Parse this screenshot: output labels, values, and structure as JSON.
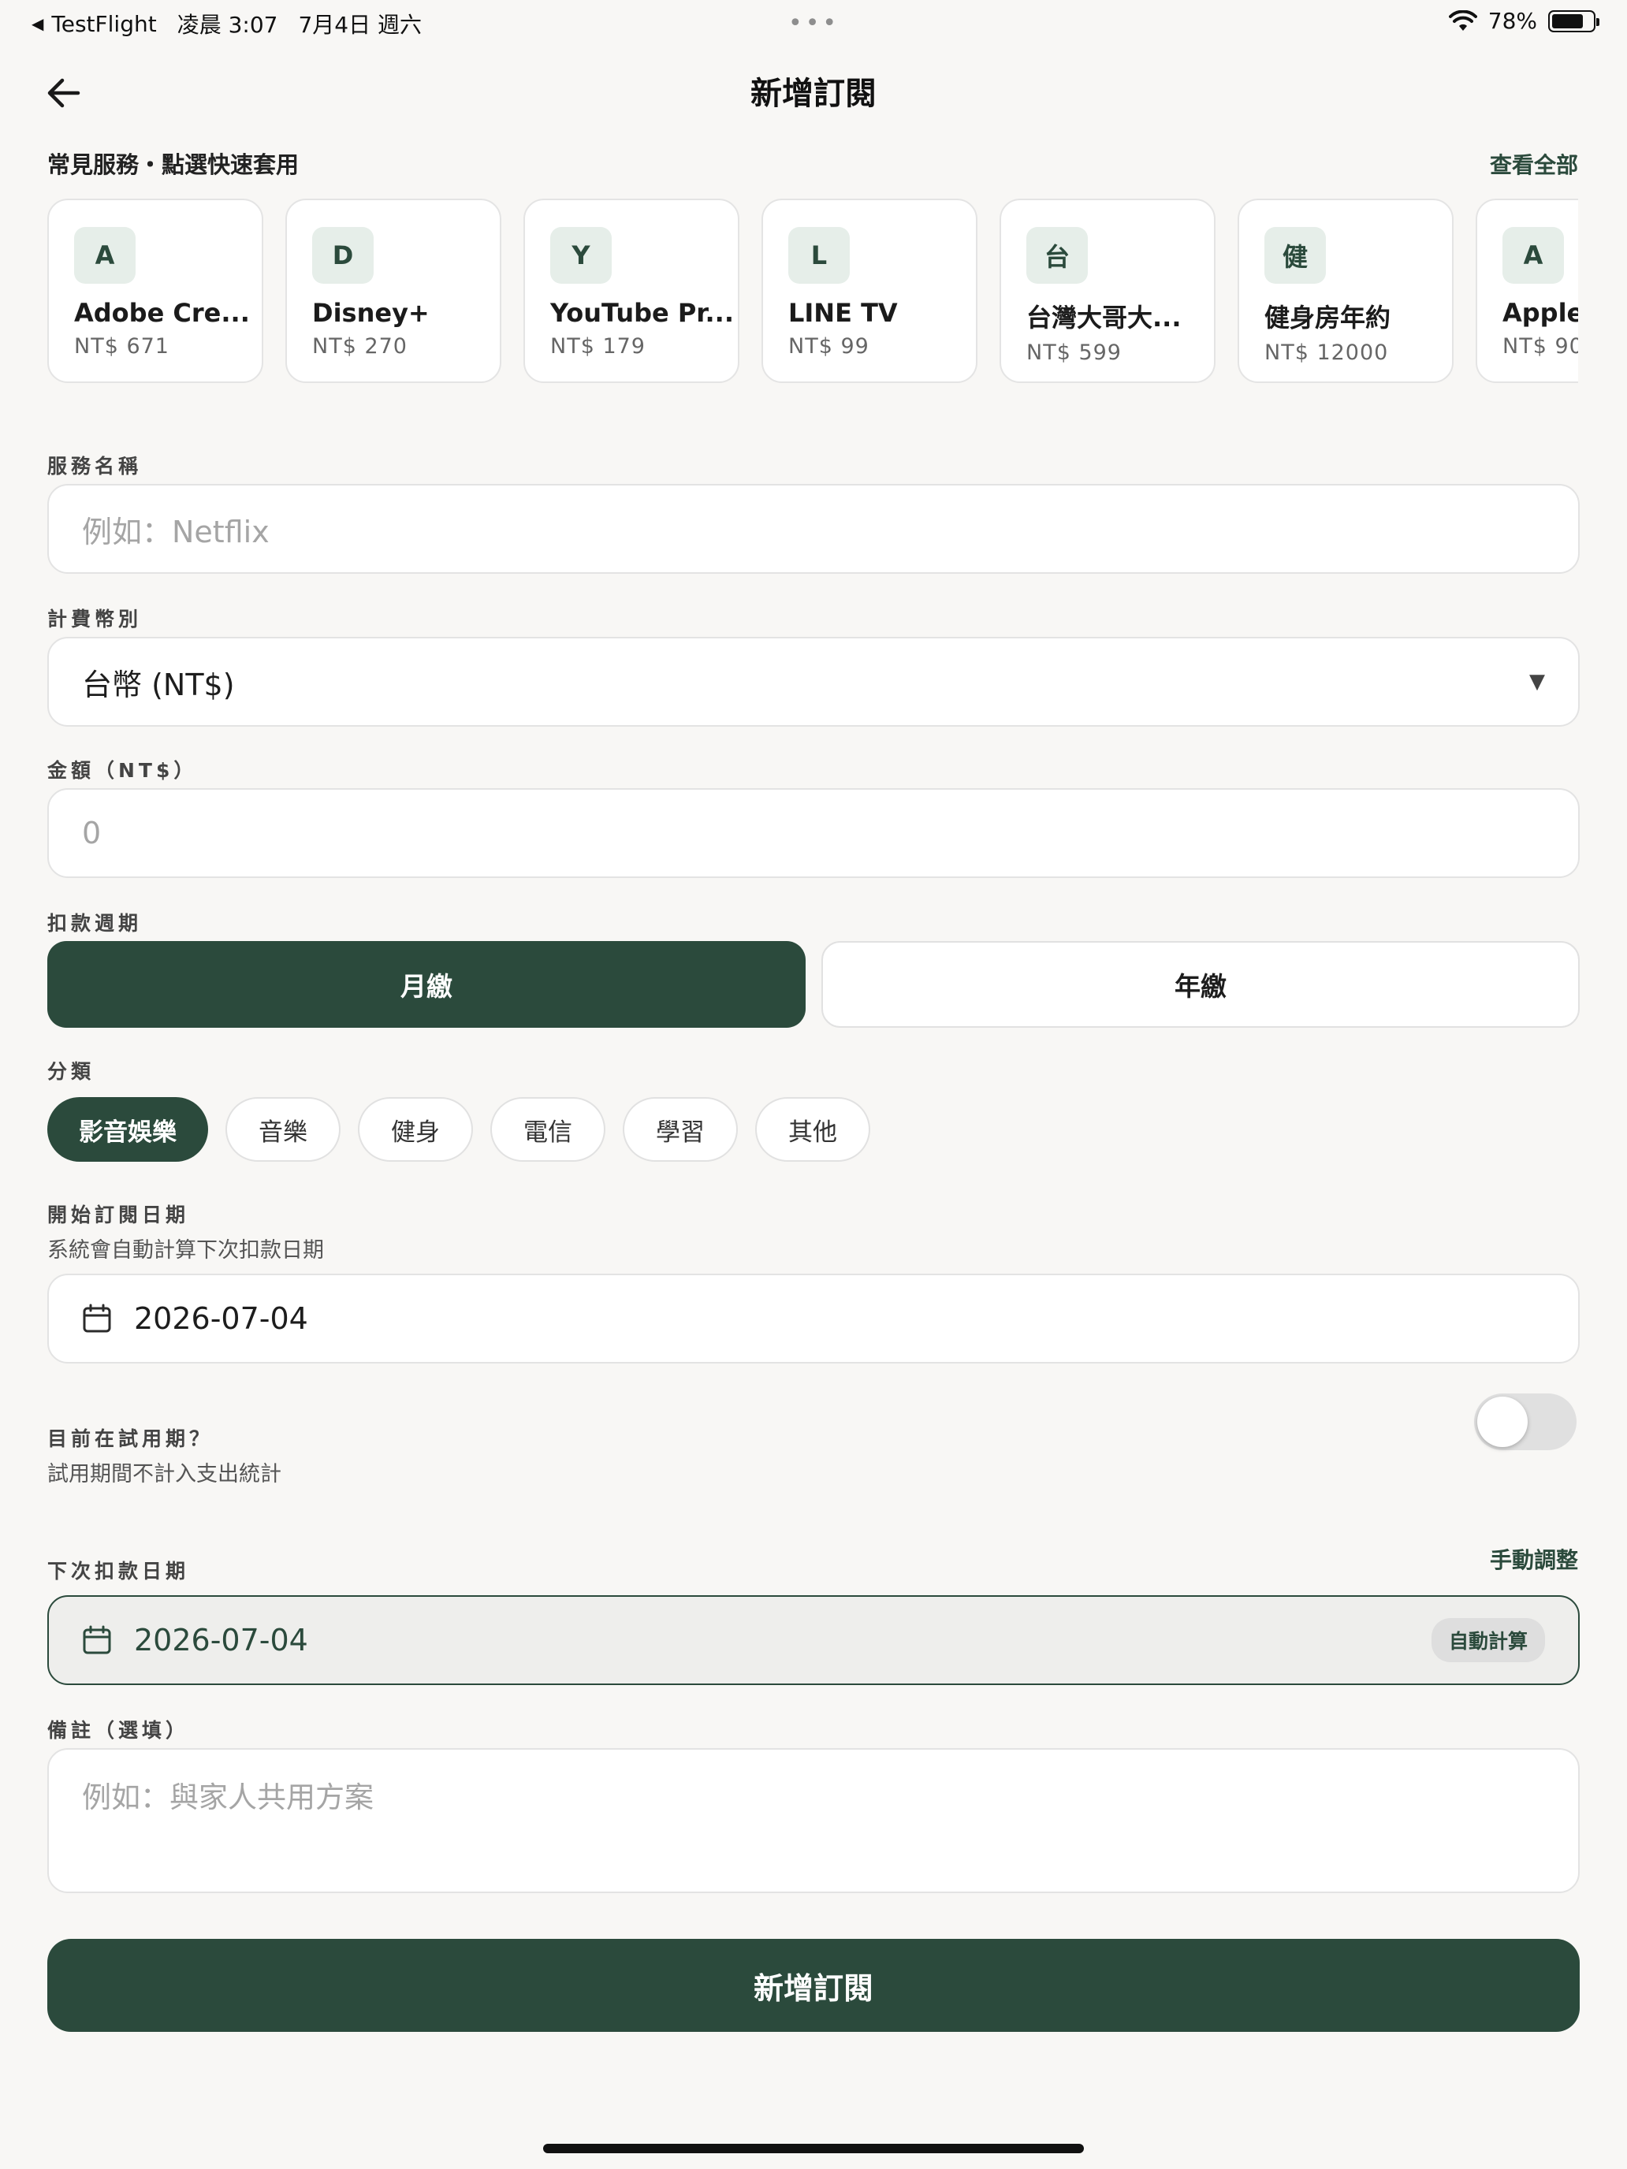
{
  "status_bar": {
    "app": "TestFlight",
    "time": "凌晨 3:07",
    "date": "7月4日 週六",
    "battery": "78%",
    "battery_level": 0.78
  },
  "header": {
    "title": "新增訂閱"
  },
  "quick": {
    "label": "常見服務・點選快速套用",
    "view_all": "查看全部",
    "cards": [
      {
        "letter": "A",
        "name": "Adobe Cre...",
        "price": "NT$ 671"
      },
      {
        "letter": "D",
        "name": "Disney+",
        "price": "NT$ 270"
      },
      {
        "letter": "Y",
        "name": "YouTube Pr...",
        "price": "NT$ 179"
      },
      {
        "letter": "L",
        "name": "LINE TV",
        "price": "NT$ 99"
      },
      {
        "letter": "台",
        "name": "台灣大哥大...",
        "price": "NT$ 599"
      },
      {
        "letter": "健",
        "name": "健身房年約",
        "price": "NT$ 12000"
      },
      {
        "letter": "A",
        "name": "Apple",
        "price": "NT$ 90"
      }
    ]
  },
  "form": {
    "service_name": {
      "label": "服務名稱",
      "placeholder": "例如：Netflix"
    },
    "currency": {
      "label": "計費幣別",
      "value": "台幣 (NT$)"
    },
    "amount": {
      "label": "金額（NT$）",
      "placeholder": "0"
    },
    "cycle": {
      "label": "扣款週期",
      "monthly": "月繳",
      "yearly": "年繳"
    },
    "category": {
      "label": "分類",
      "options": [
        "影音娛樂",
        "音樂",
        "健身",
        "電信",
        "學習",
        "其他"
      ],
      "selected": "影音娛樂"
    },
    "start_date": {
      "label": "開始訂閱日期",
      "hint": "系統會自動計算下次扣款日期",
      "value": "2026-07-04"
    },
    "trial": {
      "label": "目前在試用期？",
      "hint": "試用期間不計入支出統計",
      "enabled": false
    },
    "next_date": {
      "label": "下次扣款日期",
      "manual": "手動調整",
      "value": "2026-07-04",
      "badge": "自動計算"
    },
    "notes": {
      "label": "備註（選填）",
      "placeholder": "例如：與家人共用方案"
    },
    "submit": "新增訂閱"
  },
  "colors": {
    "accent": "#2b4a3c",
    "background": "#f8f7f5"
  }
}
